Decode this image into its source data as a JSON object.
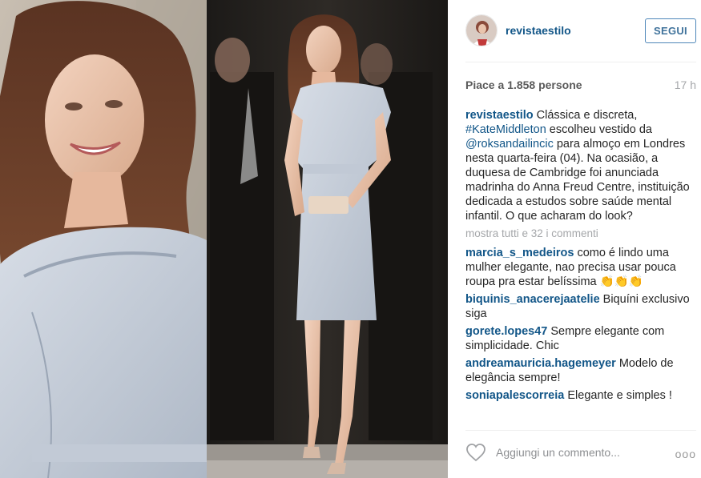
{
  "post": {
    "username": "revistaestilo",
    "follow_label": "SEGUI",
    "likes": "Piace a 1.858 persone",
    "time": "17 h",
    "caption": {
      "user": "revistaestilo",
      "part1": " Clássica e discreta, ",
      "hashtag": "#KateMiddleton",
      "part2": " escolheu vestido da ",
      "mention": "@roksandailincic",
      "part3": " para almoço em Londres nesta quarta-feira (04). Na ocasião, a duquesa de Cambridge foi anunciada madrinha do Anna Freud Centre, instituição dedicada a estudos sobre saúde mental infantil. O que acharam do look?"
    },
    "show_all": "mostra tutti e 32 i commenti",
    "comments": [
      {
        "user": "marcia_s_medeiros",
        "text": " como é lindo uma mulher elegante, nao precisa usar pouca roupa pra estar belíssima 👏👏👏"
      },
      {
        "user": "biquinis_anacerejaatelie",
        "text": " Biquíni exclusivo siga"
      },
      {
        "user": "gorete.lopes47",
        "text": " Sempre elegante com simplicidade. Chic"
      },
      {
        "user": "andreamauricia.hagemeyer",
        "text": " Modelo de elegância sempre!"
      },
      {
        "user": "soniapalescorreia",
        "text": " Elegante e simples !"
      }
    ],
    "add_comment_placeholder": "Aggiungi un commento...",
    "more_label": "ooo",
    "icons": {
      "like": "heart-outline-icon",
      "more": "more-options-icon"
    },
    "colors": {
      "link": "#125688",
      "follow_border": "#4f87b9",
      "muted": "#a5a7aa"
    }
  }
}
